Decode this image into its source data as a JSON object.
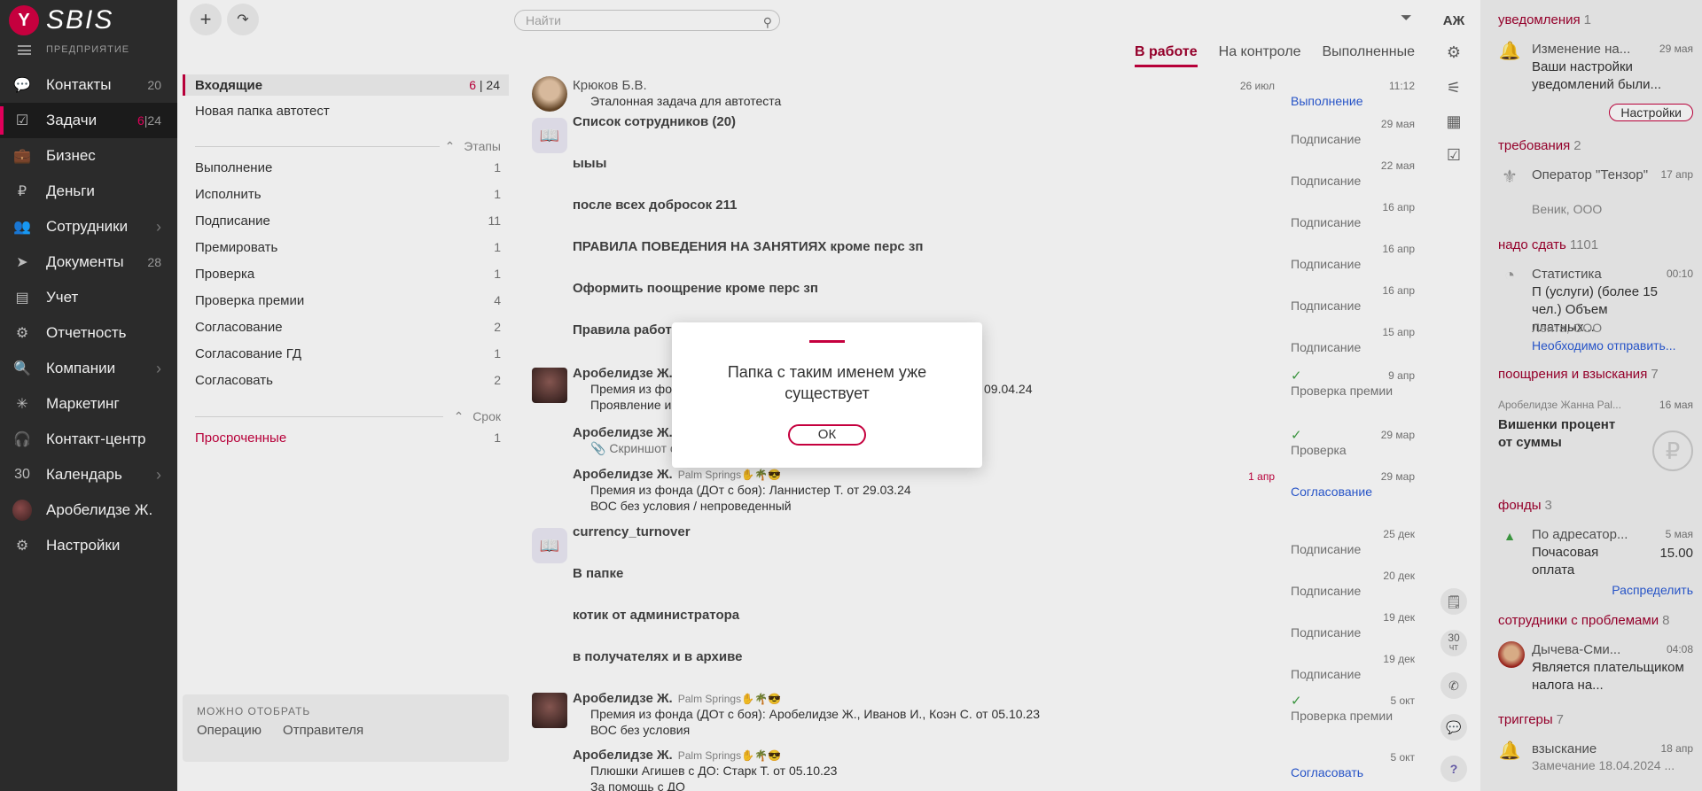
{
  "nav": {
    "logo_letter": "Y",
    "logo_word": "SBIS",
    "company": "ПРЕДПРИЯТИЕ",
    "items": [
      {
        "label": "Контакты",
        "count": "20"
      },
      {
        "label": "Задачи",
        "count_red": "6",
        "count": "24"
      },
      {
        "label": "Бизнес"
      },
      {
        "label": "Деньги"
      },
      {
        "label": "Сотрудники",
        "chev": "›"
      },
      {
        "label": "Документы",
        "count": "28"
      },
      {
        "label": "Учет"
      },
      {
        "label": "Отчетность"
      },
      {
        "label": "Компании",
        "chev": "›"
      },
      {
        "label": "Маркетинг"
      },
      {
        "label": "Контакт-центр"
      },
      {
        "label": "Календарь",
        "chev": "›"
      },
      {
        "label": "Аробелидзе Ж."
      },
      {
        "label": "Настройки"
      }
    ]
  },
  "folders": {
    "inbox_label": "Входящие",
    "inbox_count_red": "6",
    "inbox_count": "24",
    "new_folder": "Новая папка автотест",
    "stages_label": "Этапы",
    "stages": [
      {
        "label": "Выполнение",
        "n": "1"
      },
      {
        "label": "Исполнить",
        "n": "1"
      },
      {
        "label": "Подписание",
        "n": "11"
      },
      {
        "label": "Премировать",
        "n": "1"
      },
      {
        "label": "Проверка",
        "n": "1"
      },
      {
        "label": "Проверка премии",
        "n": "4"
      },
      {
        "label": "Согласование",
        "n": "2"
      },
      {
        "label": "Согласование ГД",
        "n": "1"
      },
      {
        "label": "Согласовать",
        "n": "2"
      }
    ],
    "deadline_label": "Срок",
    "overdue": {
      "label": "Просроченные",
      "n": "1"
    },
    "can_pick_title": "МОЖНО ОТОБРАТЬ",
    "can_pick_1": "Операцию",
    "can_pick_2": "Отправителя"
  },
  "main": {
    "search_placeholder": "Найти",
    "user_initials": "АЖ",
    "tabs": [
      "В работе",
      "На контроле",
      "Выполненные"
    ],
    "tasks": [
      {
        "who": "Крюков Б.В.",
        "line1": "Эталонная задача для автотеста",
        "date2": "26 июл",
        "time": "11:12",
        "stage": "Выполнение"
      },
      {
        "title": "Список сотрудников (20)",
        "date": "29 мая",
        "stage": "Подписание"
      },
      {
        "title": "ыыы",
        "date": "22 мая",
        "stage": "Подписание"
      },
      {
        "title": "после всех доброс­ок 211",
        "date": "16 апр",
        "stage": "Подписание"
      },
      {
        "title": "ПРАВИЛА ПОВЕДЕНИЯ НА ЗАНЯТИЯХ кроме перс зп",
        "date": "16 апр",
        "stage": "Подписание"
      },
      {
        "title": "Оформить поощрение кроме перс зп",
        "date": "16 апр",
        "stage": "Подписание"
      },
      {
        "title": "Правила работ",
        "date": "15 апр",
        "stage": "Подписание"
      },
      {
        "who": "Аробелидзе Ж.",
        "line1": "Премия из фонда",
        "line1b": "09.04.24",
        "line2": "Проявление и",
        "date": "9 апр",
        "stage": "Проверка премии"
      },
      {
        "who": "Аробелидзе Ж.",
        "line1": "Скриншот от",
        "date": "29 мар",
        "stage": "Проверка"
      },
      {
        "who": "Аробелидзе Ж.",
        "sub": "Palm Springs✋🌴😎",
        "line1": "Премия из фонда (ДОт с боя): Ланнистер Т. от 29.03.24",
        "line2": "ВОС без условия / непроведенный",
        "date2": "1 апр",
        "date": "29 мар",
        "stage": "Согласование"
      },
      {
        "title": "currency_turnover",
        "date": "25 дек",
        "stage": "Подписание"
      },
      {
        "title": "В папке",
        "date": "20 дек",
        "stage": "Подписание"
      },
      {
        "title": "котик от администратора",
        "date": "19 дек",
        "stage": "Подписание"
      },
      {
        "title": "в получателях и в архиве",
        "date": "19 дек",
        "stage": "Подписание"
      },
      {
        "who": "Аробелидзе Ж.",
        "sub": "Palm Springs✋🌴😎",
        "line1": "Премия из фонда (ДОт с боя): Аробелидзе Ж., Иванов И., Коэн С. от 05.10.23",
        "line2": "ВОС без условия",
        "date": "5 окт",
        "stage": "Проверка премии"
      },
      {
        "who": "Аробелидзе Ж.",
        "sub": "Palm Springs✋🌴😎",
        "line1": "Плюшки Агишев с ДО: Старк Т. от 05.10.23",
        "line2": "За помощь с ДО",
        "date": "5 окт",
        "stage": "Согласовать"
      }
    ]
  },
  "strip": {
    "calendar_day": "30",
    "calendar_dow": "ЧТ",
    "help": "?"
  },
  "right": {
    "notifications": {
      "head": "уведомления",
      "n": "1",
      "title": "Изменение на...",
      "date": "29 мая",
      "text": "Ваши настройки уведомлений были...",
      "button": "Настройки"
    },
    "requirements": {
      "head": "требования",
      "n": "2",
      "title": "Оператор \"Тензор\"",
      "date": "17 апр",
      "sub": "Веник, ООО"
    },
    "to_submit": {
      "head": "надо сдать",
      "n": "1101",
      "title": "Статистика",
      "date": "00:10",
      "text": "П (услуги) (более 15 чел.) Объем платных...",
      "sub": "Лента, ООО",
      "link": "Необходимо отправить..."
    },
    "rewards": {
      "head": "поощрения и взыскания",
      "n": "7",
      "who": "Аробелидзе Жанна",
      "who2": "Pal...",
      "date": "16 мая",
      "title": "Вишенки процент от суммы"
    },
    "funds": {
      "head": "фонды",
      "n": "3",
      "title": "По адресатор...",
      "date": "5 мая",
      "text": "Почасовая оплата",
      "amount": "15.00",
      "link": "Распределить"
    },
    "problems": {
      "head": "сотрудники с проблемами",
      "n": "8",
      "title": "Дычева-Сми...",
      "date": "04:08",
      "text": "Является плательщиком налога на..."
    },
    "triggers": {
      "head": "триггеры",
      "n": "7",
      "title": "взыскание",
      "date": "18 апр",
      "text": "Замечание 18.04.2024 ..."
    }
  },
  "dialog": {
    "message": "Папка с таким именем уже существует",
    "ok": "ОК"
  }
}
